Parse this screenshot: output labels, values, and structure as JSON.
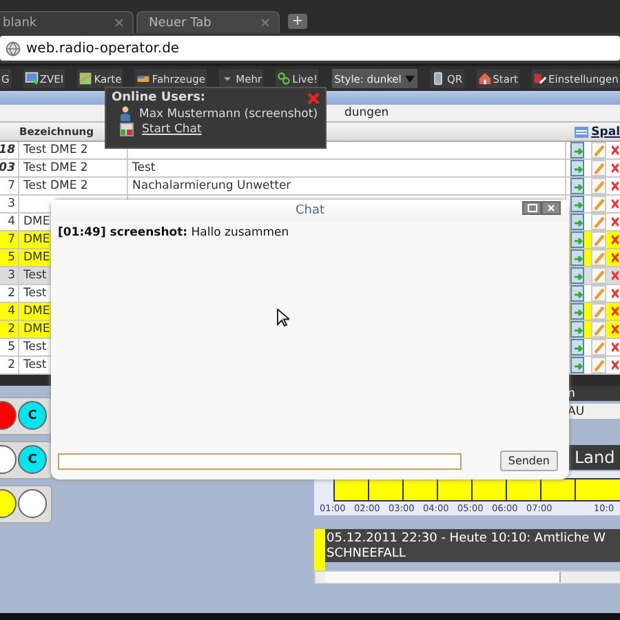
{
  "browser": {
    "tabs": [
      {
        "label": "blank",
        "selected": false
      },
      {
        "label": "Neuer Tab",
        "selected": true
      }
    ],
    "new_tab": "+",
    "address": "web.radio-operator.de"
  },
  "toolbar": [
    {
      "kind": "button",
      "label": "G"
    },
    {
      "kind": "button",
      "label": "ZVEI"
    },
    {
      "kind": "button",
      "label": "Karte"
    },
    {
      "kind": "button",
      "label": "Fahrzeuge"
    },
    {
      "kind": "button",
      "label": "Mehr"
    },
    {
      "kind": "button",
      "label": "Live!"
    },
    {
      "kind": "select",
      "label": "Style: dunkel"
    },
    {
      "kind": "button",
      "label": "QR"
    },
    {
      "kind": "button",
      "label": "Start"
    },
    {
      "kind": "button",
      "label": "Einstellungen"
    }
  ],
  "online_popup": {
    "title": "Online Users:",
    "user": "Max Mustermann (screenshot)",
    "action": "Start Chat"
  },
  "subtitle": "dungen",
  "table": {
    "columns": [
      "Bezeichnung",
      "Spal"
    ],
    "rows": [
      {
        "number": "18",
        "emphasized": true,
        "name": "Test DME 2",
        "color": "#ffffff"
      },
      {
        "number": "03",
        "emphasized": true,
        "name": "Test DME 2",
        "text": "Test",
        "color": "#ffffff"
      },
      {
        "number": "7",
        "emphasized": false,
        "name": "Test DME 2",
        "text": "Nachalarmierung Unwetter",
        "color": "#ffffff"
      },
      {
        "number": "3",
        "emphasized": false,
        "color": "#ffffff"
      },
      {
        "number": "4",
        "emphasized": false,
        "name": "DME",
        "color": "#ffffff"
      },
      {
        "number": "7",
        "emphasized": false,
        "name": "DME",
        "color": "#ffff00"
      },
      {
        "number": "5",
        "emphasized": false,
        "name": "DME",
        "color": "#ffff00"
      },
      {
        "number": "3",
        "emphasized": false,
        "name": "Test",
        "color": "#dcdcdc"
      },
      {
        "number": "2",
        "emphasized": false,
        "name": "Test",
        "color": "#ffffff"
      },
      {
        "number": "4",
        "emphasized": false,
        "name": "DME",
        "color": "#ffff00"
      },
      {
        "number": "2",
        "emphasized": false,
        "name": "DME",
        "color": "#ffff00"
      },
      {
        "number": "5",
        "emphasized": false,
        "name": "Test",
        "color": "#ffffff"
      },
      {
        "number": "2",
        "emphasized": false,
        "name": "Test",
        "color": "#ffffff"
      }
    ]
  },
  "status_lamps": [
    [
      {
        "color": "#ff0000"
      },
      {
        "color": "#00e5ee",
        "label": "C"
      }
    ],
    [
      {
        "color": "#ffffff"
      },
      {
        "color": "#00e5ee",
        "label": "C"
      }
    ],
    [
      {
        "color": "#ffff00"
      },
      {
        "color": "#ffffff"
      }
    ]
  ],
  "right_panel": {
    "header": "n",
    "field": "AU",
    "banner": "Land",
    "timeline_labels": [
      "01:00",
      "02:00",
      "03:00",
      "04:00",
      "05:00",
      "06:00",
      "07:00",
      "10:0"
    ],
    "notice": {
      "color": "#ffff00",
      "lines": [
        "05.12.2011 22:30 - Heute 10:10: Amtliche W",
        "SCHNEEFALL"
      ]
    }
  },
  "chat": {
    "title": "Chat",
    "messages": [
      {
        "time": "[01:49]",
        "user": "screenshot:",
        "text": "Hallo zusammen"
      }
    ],
    "send": "Senden"
  }
}
